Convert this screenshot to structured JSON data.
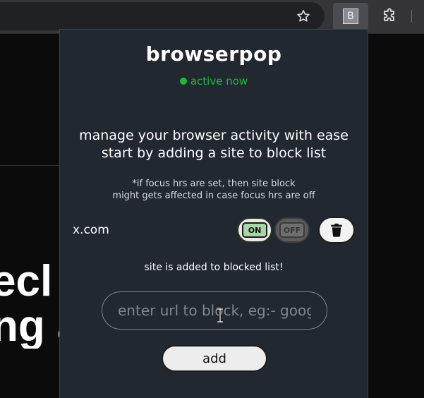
{
  "browser": {
    "extension_badge": "B",
    "icons": {
      "bookmark": "star-icon",
      "extensions": "puzzle-icon"
    }
  },
  "background_page": {
    "line1": "ecl",
    "line2": "ng a"
  },
  "popup": {
    "title": "browserpop",
    "status": "active now",
    "tagline_line1": "manage your browser activity with ease",
    "tagline_line2": "start by adding a site to block list",
    "note_line1": "*if focus hrs are set, then site block",
    "note_line2": "might gets affected in case focus hrs are off",
    "blocked_sites": [
      {
        "site": "x.com",
        "on_label": "ON",
        "off_label": "OFF",
        "state": "on"
      }
    ],
    "confirmation": "site is added to blocked list!",
    "url_input": {
      "value": "",
      "placeholder": "enter url to block, eg:- google.com"
    },
    "add_button": "add",
    "colors": {
      "popup_bg": "#212830",
      "status_green": "#1fb93a",
      "on_pill": "#a7d6a7",
      "off_pill": "#6f6f70"
    }
  }
}
